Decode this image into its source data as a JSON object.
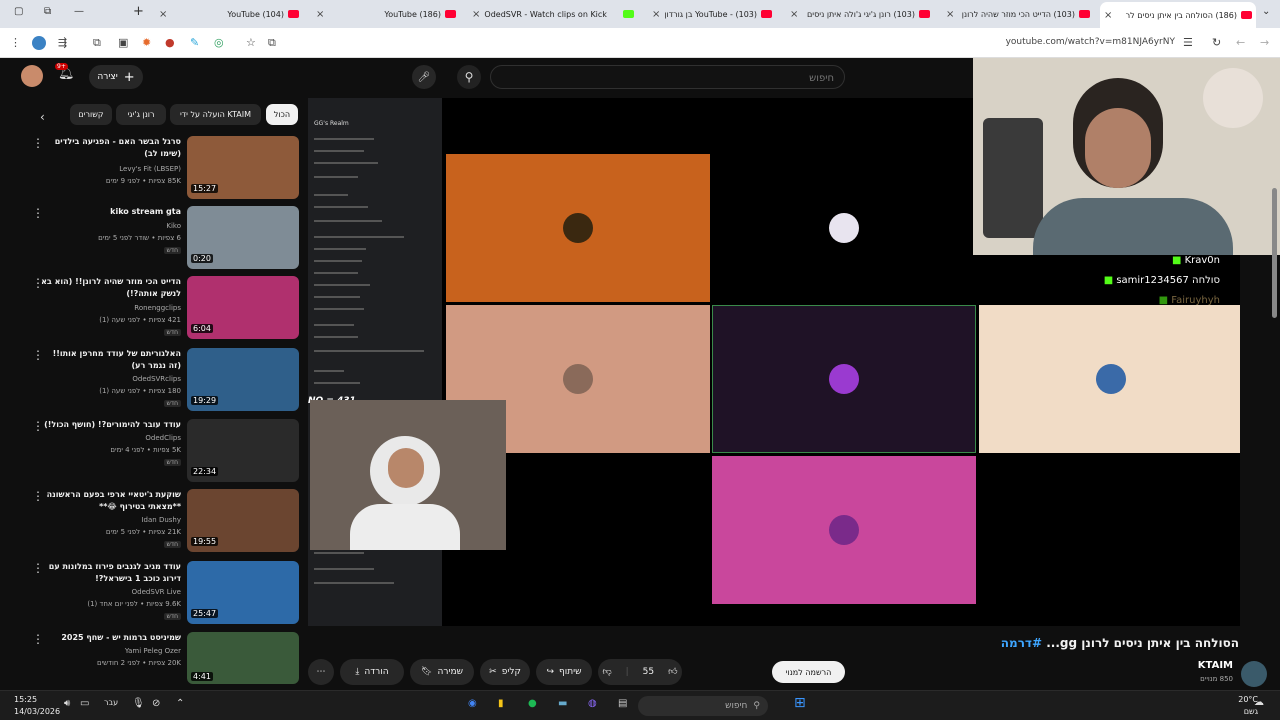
{
  "browser": {
    "tabs": [
      {
        "title": "(104) YouTube",
        "icon": "youtube-icon"
      },
      {
        "title": "(186) YouTube",
        "icon": "youtube-icon"
      },
      {
        "title": "OdedSVR - Watch clips on Kick",
        "icon": "kick-icon"
      },
      {
        "title": "YouTube - (103) בן גורדון",
        "icon": "youtube-icon"
      },
      {
        "title": "(103) רונן ג'יגי ג'ולה איתן ניסים",
        "icon": "youtube-icon"
      },
      {
        "title": "(103) הדייט הכי מוזר שהיה לרונן",
        "icon": "youtube-icon"
      },
      {
        "title": "(186) הסולחה בין איתן ניסים לר",
        "icon": "youtube-icon",
        "active": true
      }
    ],
    "url": "youtube.com/watch?v=m81NJA6yrNY"
  },
  "header": {
    "search_placeholder": "חיפוש",
    "create_label": "יצירה",
    "notif_count": "9+"
  },
  "chips": [
    "הכול",
    "הועלה על ידי KTAIM",
    "רונן ג'יגי",
    "קשורים"
  ],
  "recommendations": [
    {
      "title": "סרגל הבשר האם - הפגיעה בילדים (שימו לב)",
      "channel": "Levy's Fit (LBSEP)",
      "meta": "85K צפיות • לפני 9 ימים",
      "duration": "15:27",
      "thumb": "#8e5a3a"
    },
    {
      "title": "kiko stream gta",
      "channel": "Kiko",
      "meta": "6 צפיות • שודר לפני 5 ימים",
      "duration": "0:20",
      "badge": "חדש",
      "thumb": "#7f8c96"
    },
    {
      "title": "הדייט הכי מוזר שהיה לרונן!! (הוא בא לנשק אותה?!)",
      "channel": "Ronenggclips",
      "meta": "421 צפיות • לפני שעה (1)",
      "duration": "6:04",
      "badge": "חדש",
      "thumb": "#b0306e"
    },
    {
      "title": "האלגוריתם של עודד מחרפן אותו!! (זה נגמר רע)",
      "channel": "OdedSVRclips",
      "meta": "180 צפיות • לפני שעה (1)",
      "duration": "19:29",
      "badge": "חדש",
      "thumb": "#2f5f8a"
    },
    {
      "title": "עודד עובר להימורים?! (חושף הכול!)",
      "channel": "OdedClips",
      "meta": "5K צפיות • לפני 4 ימים",
      "duration": "22:34",
      "badge": "חדש",
      "thumb": "#2a2a2a"
    },
    {
      "title": "שוקעת ג'יטאיי ארפי בפעם הראשונה **מצאתי בטירוף 😂**",
      "channel": "Idan Dushy",
      "meta": "21K צפיות • לפני 5 ימים",
      "duration": "19:55",
      "badge": "חדש",
      "thumb": "#6b4530"
    },
    {
      "title": "עודד מגיב לגנבים פירוז במלונות עם דירוג כוכב 1 בישראל?!",
      "channel": "OdedSVR Live",
      "meta": "9.6K צפיות • לפני יום אחד (1)",
      "duration": "25:47",
      "badge": "חדש",
      "thumb": "#2d6aa8"
    },
    {
      "title": "שמיניסט ברמות יש - שחף 2025",
      "channel": "Yami Peleg Ozer",
      "meta": "20K צפיות • לפני 2 חודשים",
      "duration": "4:41",
      "thumb": "#3a5a3a"
    }
  ],
  "video": {
    "discord_server": "GG's Realm",
    "chat": [
      {
        "user": "Krav0n",
        "msg": "",
        "color": "#53fc18"
      },
      {
        "user": "samir1234567",
        "msg": "סולחה",
        "color": "#53fc18"
      },
      {
        "user": "Fairuyhyh",
        "msg": "",
        "color": "#c8a86a"
      }
    ],
    "tile_colors": [
      "#c8621d",
      "#000000",
      "#d19a82",
      "#1f1226",
      "#f1dcc6",
      "#c9479c"
    ],
    "overlay_text": "NO = 431"
  },
  "below": {
    "title_prefix": "#דרמה",
    "title_main": "הסולחה בין איתן ניסים לרונן gg...",
    "channel_name": "KTAIM",
    "subscribers": "850 מנויים",
    "subscribe_label": "הרשמה למנוי",
    "likes": "55",
    "share_label": "שיתוף",
    "clip_label": "קליפ",
    "save_label": "שמירה",
    "download_label": "הורדה"
  },
  "taskbar": {
    "time": "15:25",
    "date": "14/03/2026",
    "search_label": "חיפוש",
    "lang": "עבר",
    "temp": "20°C",
    "weather": "גשם"
  }
}
